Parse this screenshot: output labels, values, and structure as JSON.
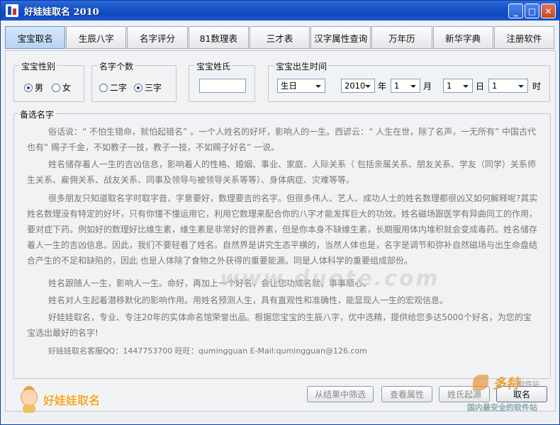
{
  "window": {
    "title": "好娃娃取名  2010",
    "minimize": "_",
    "maximize": "□",
    "close": "✕"
  },
  "tabs": [
    {
      "label": "宝宝取名"
    },
    {
      "label": "生辰八字"
    },
    {
      "label": "名字评分"
    },
    {
      "label": "81数理表"
    },
    {
      "label": "三才表"
    },
    {
      "label": "汉字属性查询"
    },
    {
      "label": "万年历"
    },
    {
      "label": "新华字典"
    },
    {
      "label": "注册软件"
    }
  ],
  "gender": {
    "label": "宝宝性别",
    "options": [
      "男",
      "女"
    ],
    "selected": "男"
  },
  "name_count": {
    "label": "名字个数",
    "options": [
      "二字",
      "三字"
    ],
    "selected": "三字"
  },
  "surname": {
    "label": "宝宝姓氏",
    "value": ""
  },
  "birth": {
    "label": "宝宝出生时间",
    "calendar": "生日",
    "year": "2010",
    "year_unit": "年",
    "month": "1",
    "month_unit": "月",
    "day": "1",
    "day_unit": "日",
    "hour": "1",
    "hour_unit": "时"
  },
  "candidates": {
    "label": "备选名字",
    "paragraphs": [
      "俗话说：“ 不怕生错命，就怕起错名”  。一个人姓名的好坏，影响人的一生。西谚云：“ 人生在世，除了名声，一无所有” 中国古代也有“ 赐子千金，不如教子一技，教子一技，不如赐子好名” 一说。",
      "姓名储存着人一生的吉凶信息，影响着人的性格、婚姻、事业、家庭、人际关系（ 包括亲属关系、朋友关系、学友（同学）关系师生关系、雇佣关系、战友关系、同事及领导与被领导关系等等）、身体病症、灾难等等。",
      "很多朋友只知道取名字时取字音、字意要好，数理要吉的名字。但很多伟人、艺人、成功人士的姓名数理都很凶又如何解释呢?其实姓名数理没有特定的好坏，只有你懂不懂运用它，利用它数理来配合你的八字才能发挥巨大的功效。姓名磁场跟医学有异曲同工的作用，要对症下药。例如好的数理好比维生素，维生素是非常好的营养素，但是你本身不缺维生素，长期服用体内堆积就会变成毒药。姓名储存着人一生的吉凶信息。因此，我们不要轻看了姓名。自然界是讲究生态平横的，当然人体也是，名字是调节和弥补自然磁场与出生命盘结合产生的不足和缺陷的，因此 也是人体除了食物之外获得的重要能源。同是人体科学的重要组成部份。",
      "姓名跟随人一生，影响人一生。命好，再加上一个好名，会让您功成名就，事事顺心。",
      "姓名对人生起着潜移默化的影响作用。用姓名预测人生，具有直观性和准确性，能显现人一生的宏观信息。",
      "好娃娃取名，专业、专注20年的实体命名馆荣誉出品。根据您宝宝的生辰八字，优中选精，提供给您多达5000个好名，为您的宝宝选出最好的名字!",
      "好娃娃取名客服QQ：1447753700 旺旺：qumingguan    E-Mail:qumingguan@126.com"
    ]
  },
  "watermark": "www.duote.com",
  "buttons": {
    "filter": "从结果中筛选",
    "attributes": "查看属性",
    "origin": "姓氏起源",
    "name": "取名"
  },
  "logo": {
    "text": "好娃娃取名"
  },
  "corner": {
    "brand": "多特",
    "tag": "软件站",
    "slogan": "国内最安全的软件站"
  }
}
